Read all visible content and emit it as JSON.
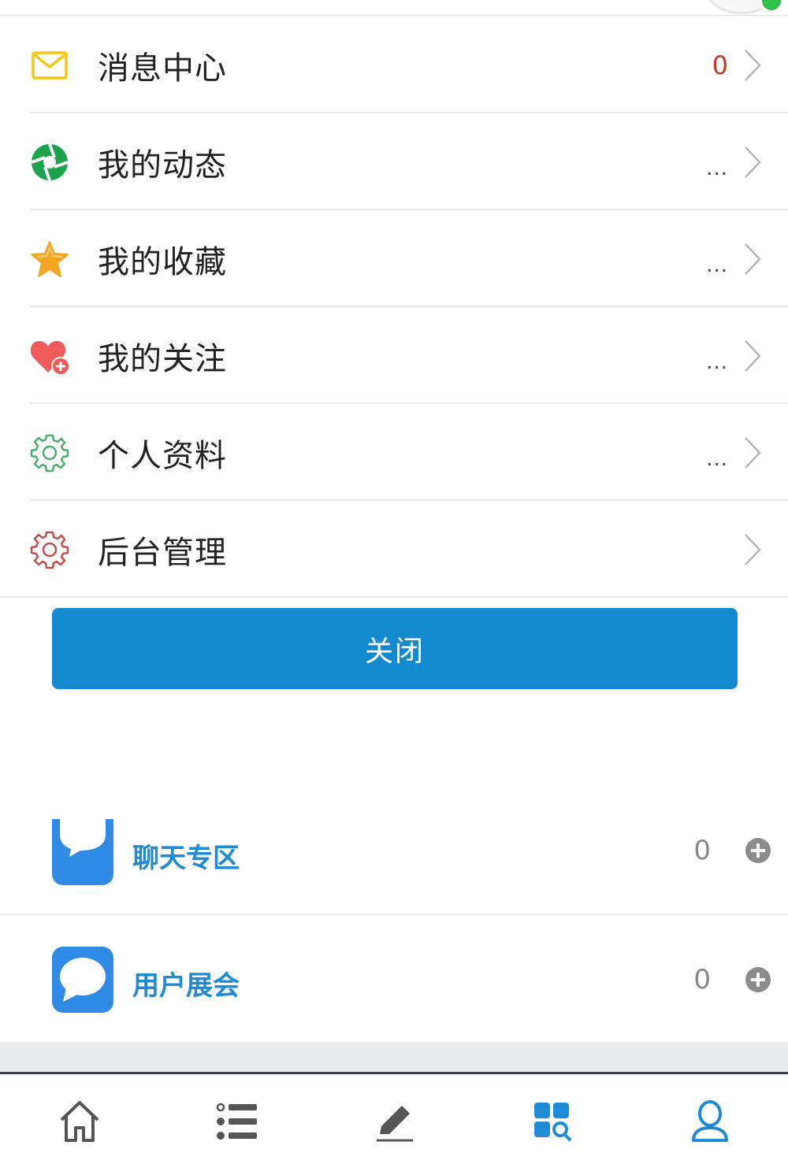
{
  "menu": {
    "items": [
      {
        "label": "消息中心",
        "value": "0",
        "icon": "mail-icon",
        "color": "#f5c518"
      },
      {
        "label": "我的动态",
        "value": "...",
        "icon": "aperture-icon",
        "color": "#1aa34a"
      },
      {
        "label": "我的收藏",
        "value": "...",
        "icon": "star-icon",
        "color": "#f5a623"
      },
      {
        "label": "我的关注",
        "value": "...",
        "icon": "heart-plus-icon",
        "color": "#ef5b5b"
      },
      {
        "label": "个人资料",
        "value": "...",
        "icon": "gear-icon",
        "color": "#4cae6b"
      },
      {
        "label": "后台管理",
        "value": "",
        "icon": "gear-icon",
        "color": "#c0504d"
      }
    ]
  },
  "close_button": {
    "label": "关闭",
    "color": "#1389d0"
  },
  "forums": [
    {
      "name": "聊天专区",
      "count": "0",
      "icon": "chat-bubble-icon"
    },
    {
      "name": "用户展会",
      "count": "0",
      "icon": "chat-bubble-icon"
    }
  ],
  "tabbar": {
    "items": [
      {
        "icon": "home-icon",
        "label": ""
      },
      {
        "icon": "list-icon",
        "label": ""
      },
      {
        "icon": "edit-icon",
        "label": ""
      },
      {
        "icon": "apps-search-icon",
        "label": "",
        "active": true
      },
      {
        "icon": "user-icon",
        "label": ""
      }
    ],
    "active_color": "#1f8ad6"
  }
}
